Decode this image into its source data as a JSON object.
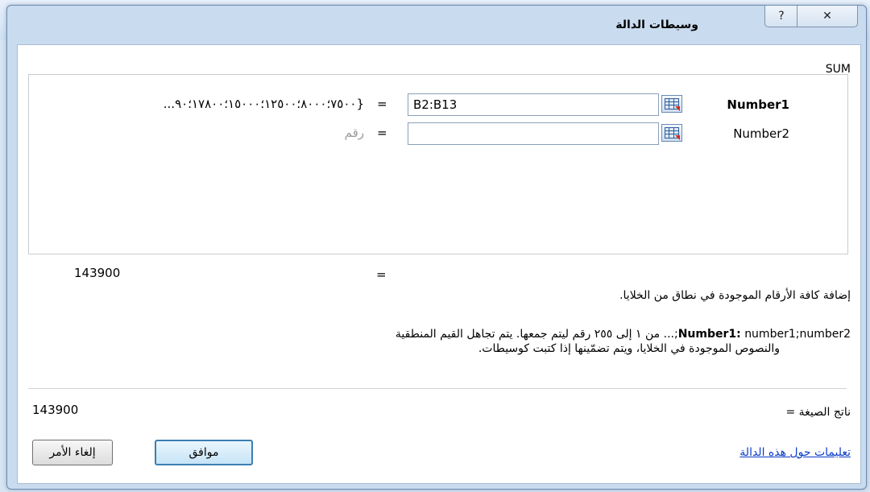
{
  "dialog": {
    "title": "وسيطات الدالة",
    "help_glyph": "?",
    "close_glyph": "✕"
  },
  "function_name": "SUM",
  "arguments": [
    {
      "name": "Number1",
      "value": "B2:B13",
      "preview": "{٧٥٠٠؛٨٠٠٠؛١٢٥٠٠؛١٥٠٠٠؛١٧٨٠٠؛٩٠...",
      "equals": "="
    },
    {
      "name": "Number2",
      "value": "",
      "preview": "رقم",
      "equals": "="
    }
  ],
  "function_result": {
    "equals": "=",
    "value": "143900"
  },
  "description": "إضافة كافة الأرقام الموجودة في نطاق من الخلايا.",
  "arg_help": {
    "label": "Number1:",
    "text_line1": "number1;number2;... من ١ إلى ٢٥٥ رقم ليتم جمعها. يتم تجاهل القيم المنطقية",
    "text_line2": "والنصوص الموجودة في الخلايا، ويتم تضمّينها إذا كتبت كوسيطات."
  },
  "formula_result": {
    "label": "ناتج الصيغة =",
    "value": "143900"
  },
  "help_link": "تعليمات حول هذه الدالة",
  "buttons": {
    "ok": "موافق",
    "cancel": "إلغاء الأمر"
  },
  "icons": {
    "ref": "range-select-icon"
  }
}
